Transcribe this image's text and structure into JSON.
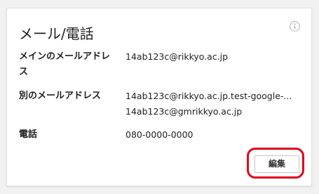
{
  "card": {
    "title": "メール/電話",
    "info_icon": "info-icon"
  },
  "rows": {
    "primary_email": {
      "label": "メインのメールアドレス",
      "values": [
        "14ab123c@rikkyo.ac.jp"
      ]
    },
    "alternate_email": {
      "label": "別のメールアドレス",
      "values": [
        "14ab123c@rikkyo.ac.jp.test-google-...",
        "14ab123c@gmrikkyo.ac.jp"
      ]
    },
    "phone": {
      "label": "電話",
      "values": [
        "080-0000-0000"
      ]
    }
  },
  "actions": {
    "edit_label": "編集"
  },
  "colors": {
    "highlight": "#e0001b",
    "background": "#f1f1f1",
    "card": "#ffffff"
  }
}
